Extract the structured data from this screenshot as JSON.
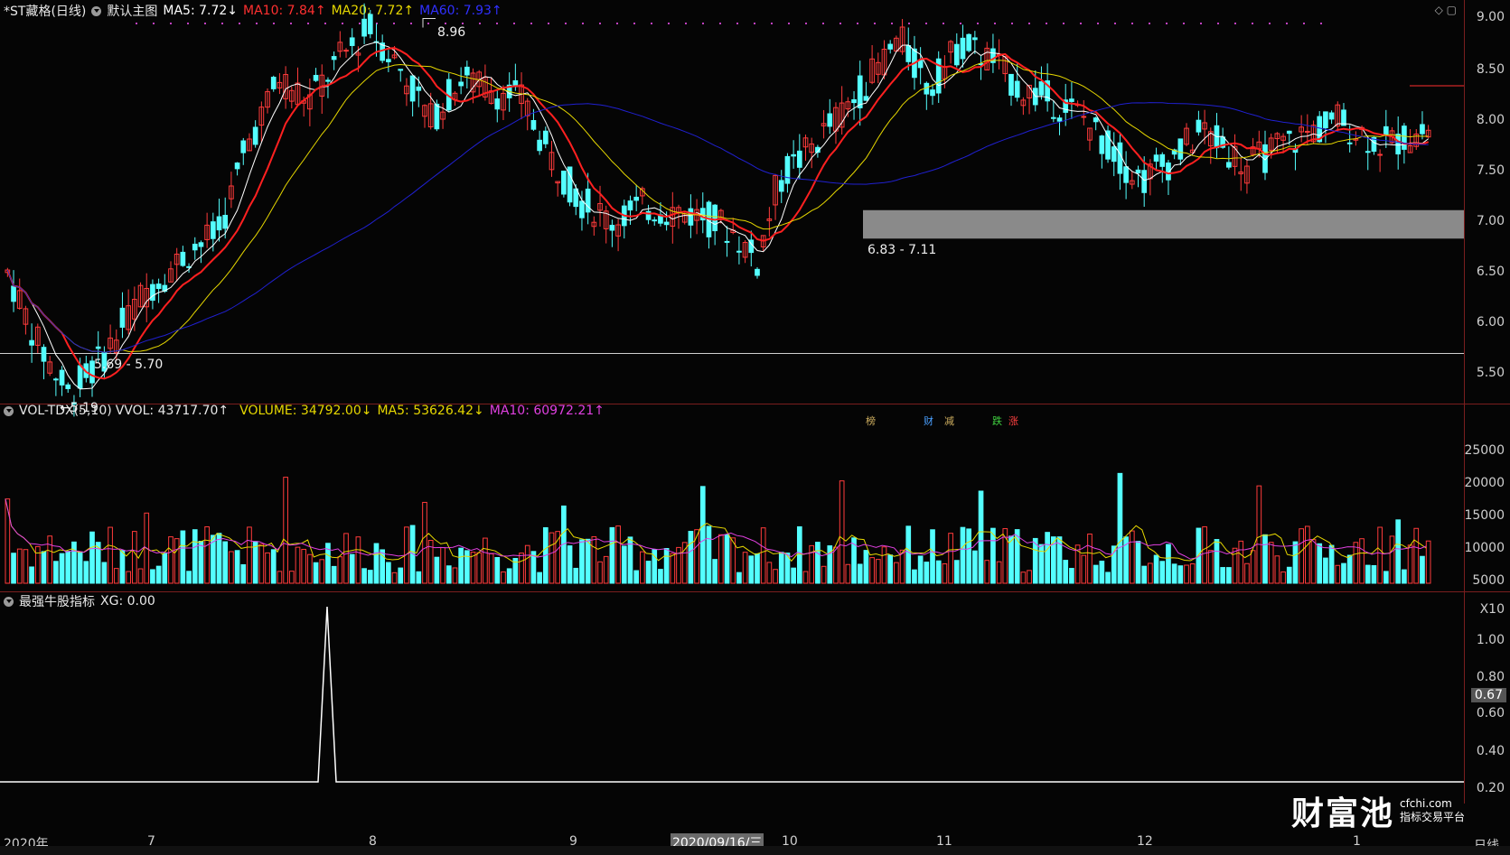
{
  "main_header": {
    "title": "*ST藏格(日线)",
    "template": "默认主图",
    "ma5": "MA5: 7.72↓",
    "ma10": "MA10: 7.84↑",
    "ma20": "MA20: 7.72↑",
    "ma60": "MA60: 7.93↑"
  },
  "vol_header": {
    "name": "VOL-TDX(5,10)",
    "vvol": "VVOL: 43717.70↑",
    "volume": "VOLUME: 34792.00↓",
    "ma5": "MA5: 53626.42↓",
    "ma10": "MA10: 60972.21↑"
  },
  "ind_header": {
    "name": "最强牛股指标",
    "xg": "XG: 0.00"
  },
  "annotations": {
    "high": "8.96",
    "low": "←5.19",
    "zone1": "5.69 - 5.70",
    "zone2": "6.83 - 7.11"
  },
  "event_tags": [
    {
      "text": "榜",
      "color": "#d0b060"
    },
    {
      "text": "财",
      "color": "#4aa0ff"
    },
    {
      "text": "减",
      "color": "#d0b060"
    },
    {
      "text": "跌",
      "color": "#40d040"
    },
    {
      "text": "涨",
      "color": "#ff4040"
    }
  ],
  "price_axis": [
    "9.00",
    "8.50",
    "8.00",
    "7.50",
    "7.00",
    "6.50",
    "6.00",
    "5.50"
  ],
  "vol_axis": [
    "25000",
    "20000",
    "15000",
    "10000",
    "5000",
    "X10"
  ],
  "ind_axis": [
    "1.00",
    "0.80",
    "0.67",
    "0.60",
    "0.40",
    "0.20"
  ],
  "x_axis": [
    "2020年",
    "7",
    "8",
    "9",
    "10",
    "11",
    "12",
    "1"
  ],
  "cursor_date": "2020/09/16/三",
  "period_label": "日线",
  "logo": {
    "brand": "财富池",
    "site": "cfchi.com",
    "tagline": "指标交易平台"
  },
  "colors": {
    "up": "#ff3b3b",
    "down": "#54ffff",
    "ma5": "#ffffff",
    "ma10": "#ff2020",
    "ma20": "#e6d700",
    "ma60": "#2020d0"
  }
}
